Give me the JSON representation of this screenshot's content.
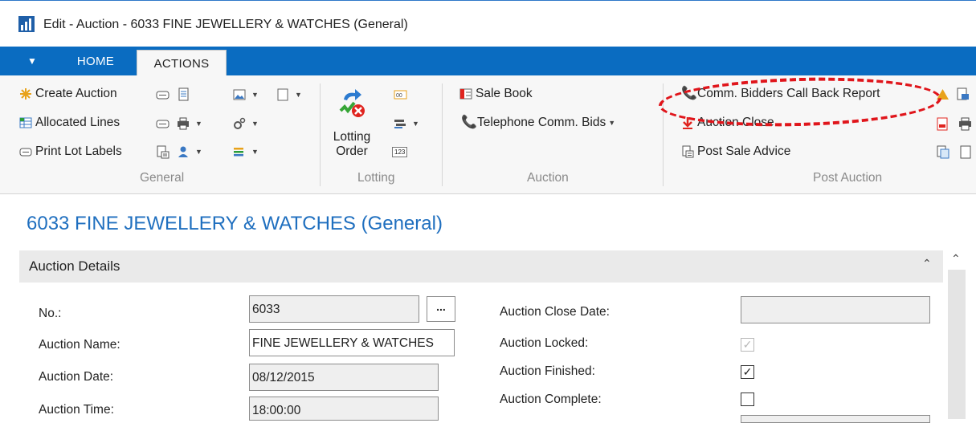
{
  "window": {
    "title": "Edit - Auction - 6033 FINE JEWELLERY & WATCHES (General)"
  },
  "tabs": {
    "home": "HOME",
    "actions": "ACTIONS"
  },
  "ribbon": {
    "general": {
      "label": "General",
      "create_auction": "Create Auction",
      "allocated_lines": "Allocated Lines",
      "print_lot_labels": "Print Lot Labels"
    },
    "lotting": {
      "label": "Lotting",
      "lotting_order_line1": "Lotting",
      "lotting_order_line2": "Order",
      "counter_badge": "123"
    },
    "auction": {
      "label": "Auction",
      "sale_book": "Sale Book",
      "telephone_comm_bids": "Telephone Comm. Bids"
    },
    "post_auction": {
      "label": "Post Auction",
      "comm_bidders_call_back_report": "Comm. Bidders Call Back Report",
      "auction_close": "Auction Close",
      "post_sale_advice": "Post Sale Advice"
    }
  },
  "page": {
    "title": "6033 FINE JEWELLERY & WATCHES (General)"
  },
  "section": {
    "title": "Auction Details"
  },
  "fields": {
    "no": {
      "label": "No.:",
      "value": "6033",
      "lookup": "..."
    },
    "auction_name": {
      "label": "Auction Name:",
      "value": "FINE JEWELLERY & WATCHES"
    },
    "auction_date": {
      "label": "Auction Date:",
      "value": "08/12/2015"
    },
    "auction_time": {
      "label": "Auction Time:",
      "value": "18:00:00"
    },
    "auction_close_date": {
      "label": "Auction Close Date:",
      "value": ""
    },
    "auction_locked": {
      "label": "Auction Locked:",
      "checked": true,
      "enabled": false
    },
    "auction_finished": {
      "label": "Auction Finished:",
      "checked": true,
      "enabled": true
    },
    "auction_complete": {
      "label": "Auction Complete:",
      "checked": false,
      "enabled": true
    }
  },
  "colors": {
    "accent": "#0a6cc1",
    "title_blue": "#1f6fbf",
    "annotation_red": "#e0151b"
  }
}
